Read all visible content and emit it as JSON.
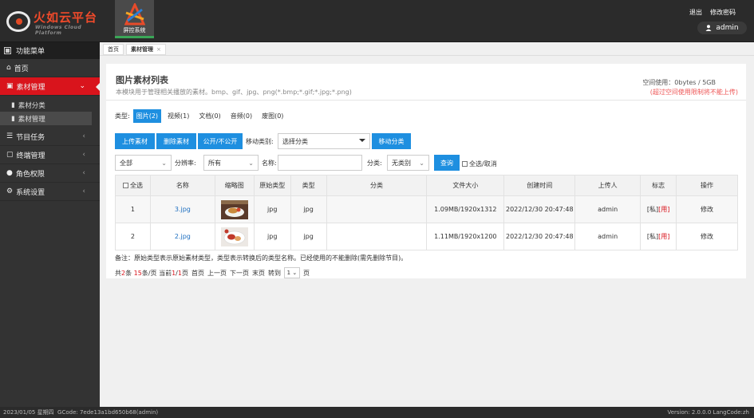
{
  "brand": {
    "title": "火如云平台",
    "subtitle": "Windows Cloud Platform"
  },
  "module": {
    "label": "屏控系统"
  },
  "top_links": {
    "logout": "退出",
    "change_password": "修改密码"
  },
  "user": {
    "name": "admin"
  },
  "sidebar": {
    "header": "功能菜单",
    "items": [
      {
        "label": "首页"
      },
      {
        "label": "素材管理"
      },
      {
        "label": "节目任务"
      },
      {
        "label": "终端管理"
      },
      {
        "label": "角色权限"
      },
      {
        "label": "系统设置"
      }
    ],
    "sub_items": [
      {
        "label": "素材分类"
      },
      {
        "label": "素材管理"
      }
    ]
  },
  "tabs": [
    {
      "label": "首页"
    },
    {
      "label": "素材管理"
    }
  ],
  "panel": {
    "title": "图片素材列表",
    "description": "本模块用于管理相关播放的素材。bmp、gif、jpg、png(*.bmp;*.gif;*.jpg;*.png)",
    "space_used": "空间使用：0bytes / 5GB",
    "space_warning": "(超过空间使用限制将不能上传)"
  },
  "type_filter": {
    "label": "类型:",
    "tabs": [
      {
        "label": "图片(2)"
      },
      {
        "label": "视频(1)"
      },
      {
        "label": "文档(0)"
      },
      {
        "label": "音频(0)"
      },
      {
        "label": "废图(0)"
      }
    ]
  },
  "actions": {
    "upload": "上传素材",
    "delete": "删除素材",
    "publicize": "公开/不公开",
    "move_label": "移动类别:",
    "move_select": "选择分类",
    "move_button": "移动分类"
  },
  "filters": {
    "scope": "全部",
    "resolution_label": "分辨率:",
    "resolution": "所有",
    "name_label": "名称:",
    "name_value": "",
    "category_label": "分类:",
    "category": "无类别",
    "search_button": "查询",
    "select_all_label": "全选/取消"
  },
  "table": {
    "headers": {
      "select_all": "全选",
      "name": "名称",
      "thumbnail": "缩略图",
      "original_type": "原始类型",
      "type": "类型",
      "category": "分类",
      "file_size": "文件大小",
      "created": "创建时间",
      "uploader": "上传人",
      "flag": "标志",
      "action": "操作"
    },
    "rows": [
      {
        "index": "1",
        "name": "3.jpg",
        "original_type": "jpg",
        "type": "jpg",
        "category": "",
        "file_size": "1.09MB/1920x1312",
        "created": "2022/12/30 20:47:48",
        "uploader": "admin",
        "flag_private": "[私]",
        "flag_used": "[用]",
        "action": "修改"
      },
      {
        "index": "2",
        "name": "2.jpg",
        "original_type": "jpg",
        "type": "jpg",
        "category": "",
        "file_size": "1.11MB/1920x1200",
        "created": "2022/12/30 20:47:48",
        "uploader": "admin",
        "flag_private": "[私]",
        "flag_used": "[用]",
        "action": "修改"
      }
    ]
  },
  "note": "备注：原始类型表示原始素材类型，类型表示转换后的类型名称。已经使用的不能删除(需先删除节目)。",
  "pager": {
    "total_prefix": "共",
    "total": "2",
    "total_unit": "条",
    "per_page": "15",
    "per_page_unit": "条/页",
    "current_label": "当前",
    "current": "1",
    "slash": "/",
    "pages": "1",
    "page_unit": "页",
    "first": "首页",
    "prev": "上一页",
    "next": "下一页",
    "last": "末页",
    "goto": "转到",
    "goto_value": "1",
    "goto_unit": "页"
  },
  "footer": {
    "date": "2023/01/05",
    "weekday": "星期四",
    "gcode": "GCode: 7ede13a1bd650b68(admin)",
    "version": "Version: 2.0.0.0 LangCode:zh"
  },
  "colors": {
    "accent": "#1e8fe0",
    "active_menu": "#d9141c",
    "module_underline": "#3aa657"
  }
}
